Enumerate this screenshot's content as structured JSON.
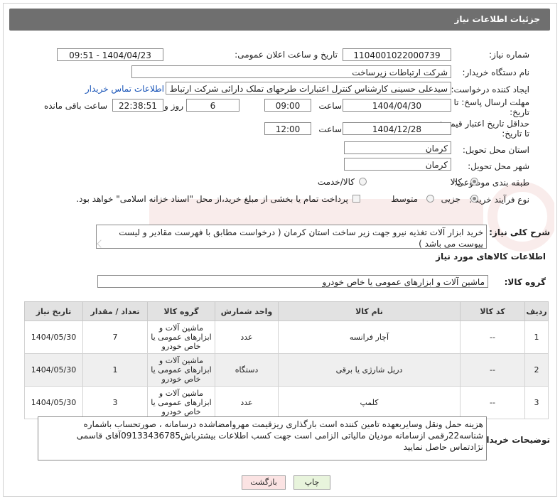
{
  "header": {
    "title": "جزئیات اطلاعات نیاز"
  },
  "form": {
    "need_number_label": "شماره نیاز:",
    "need_number": "1104001022000739",
    "announce_label": "تاریخ و ساعت اعلان عمومی:",
    "announce_value": "1404/04/23 - 09:51",
    "buyer_org_label": "نام دستگاه خریدار:",
    "buyer_org": "شرکت ارتباطات زیرساخت",
    "creator_label": "ایجاد کننده درخواست:",
    "creator": "سیدعلی حسینی کارشناس کنترل اعتبارات طرحهای تملک دارائی شرکت ارتباط",
    "buyer_contact_link": "اطلاعات تماس خریدار",
    "deadline_label_1": "مهلت ارسال پاسخ: تا",
    "deadline_label_2": "تاریخ:",
    "deadline_date": "1404/04/30",
    "time_label": "ساعت",
    "deadline_time": "09:00",
    "days_value": "6",
    "days_label": "روز و",
    "remaining_time": "22:38:51",
    "remaining_label": "ساعت باقی مانده",
    "price_valid_label_1": "حداقل تاریخ اعتبار قیمت:",
    "price_valid_label_2": "تا تاریخ:",
    "price_valid_date": "1404/12/28",
    "price_valid_time": "12:00",
    "province_label": "استان محل تحویل:",
    "province": "کرمان",
    "city_label": "شهر محل تحویل:",
    "city": "کرمان",
    "category_label": "طبقه بندی موضوعی:",
    "category_goods": "کالا",
    "category_goods_service": "کالا/خدمت",
    "process_label": "نوع فرآیند خرید :",
    "process_partial": "جزیی",
    "process_medium": "متوسط",
    "payment_note": "پرداخت تمام یا بخشی از مبلغ خرید،از محل \"اسناد خزانه اسلامی\" خواهد بود."
  },
  "description": {
    "label": "شرح کلی نیاز:",
    "text": "خرید ابزار آلات تغذیه نیرو جهت زیر ساخت استان کرمان ( درخواست مطابق با فهرست مقادیر و لیست پیوست می باشد )"
  },
  "goods_info": {
    "title": "اطلاعات کالاهای مورد نیاز",
    "group_label": "گروه کالا:",
    "group_value": "ماشین آلات و ابزارهای عمومی یا خاص خودرو"
  },
  "table": {
    "headers": [
      "ردیف",
      "کد کالا",
      "نام کالا",
      "واحد شمارش",
      "گروه کالا",
      "تعداد / مقدار",
      "تاریخ نیاز"
    ],
    "rows": [
      {
        "row": "1",
        "code": "--",
        "name": "آچار فرانسه",
        "unit": "عدد",
        "group": "ماشین آلات و ابزارهای عمومی یا خاص خودرو",
        "qty": "7",
        "date": "1404/05/30"
      },
      {
        "row": "2",
        "code": "--",
        "name": "دریل شارژی یا برقی",
        "unit": "دستگاه",
        "group": "ماشین آلات و ابزارهای عمومی یا خاص خودرو",
        "qty": "1",
        "date": "1404/05/30"
      },
      {
        "row": "3",
        "code": "--",
        "name": "کلمپ",
        "unit": "عدد",
        "group": "ماشین آلات و ابزارهای عمومی یا خاص خودرو",
        "qty": "3",
        "date": "1404/05/30"
      }
    ]
  },
  "buyer_notes": {
    "label": "توضیحات خریدار:",
    "text": "هزینه حمل ونقل وسایربعهده تامین کننده است بارگذاری ریزقیمت مهروامضاشده درسامانه ، صورتحساب باشماره شناسه22رقمی ازسامانه مودیان مالیاتی الزامی است جهت کسب اطلاعات بیشترباش09133436785آقای قاسمی نژادتماس حاصل نمایید"
  },
  "buttons": {
    "print": "چاپ",
    "back": "بازگشت"
  },
  "colors": {
    "header_bg": "#6f6f6f",
    "link": "#1a55b8",
    "back_btn_bg": "#fbe3e3",
    "print_btn_bg": "#e8f4dc"
  }
}
